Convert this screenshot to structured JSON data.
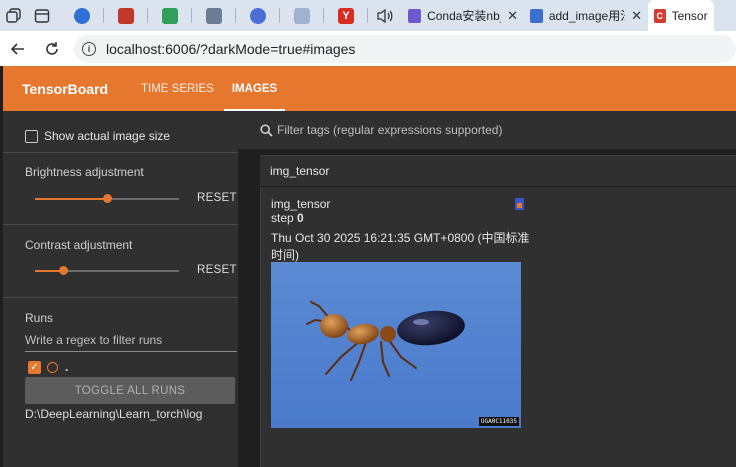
{
  "browser": {
    "tabs": [
      {
        "title": "Conda安装nb_",
        "close": "✕",
        "favicon_color": "#6a5acd"
      },
      {
        "title": "add_image用法",
        "close": "✕",
        "favicon_color": "#3b6fd4"
      },
      {
        "title": "TensorB",
        "close": "",
        "favicon_color": "#d23b2f",
        "favicon_letter": "C"
      }
    ],
    "pinned_colors": [
      "#2f6fd6",
      "#c0392b",
      "#2e9e5b",
      "#6b7c93",
      "#4a6fd4"
    ],
    "url": "localhost:6006/?darkMode=true#images"
  },
  "app": {
    "brand": "TensorBoard",
    "nav": [
      {
        "label": "TIME SERIES",
        "active": false
      },
      {
        "label": "IMAGES",
        "active": true
      }
    ],
    "accent": "#e6772f"
  },
  "sidebar": {
    "show_actual_size_label": "Show actual image size",
    "brightness_label": "Brightness adjustment",
    "brightness_value": 0.5,
    "contrast_label": "Contrast adjustment",
    "contrast_value": 0.2,
    "reset_label": "RESET",
    "runs_label": "Runs",
    "regex_placeholder": "Write a regex to filter runs",
    "run_name": ".",
    "toggle_all_label": "TOGGLE ALL RUNS",
    "log_dir": "D:\\DeepLearning\\Learn_torch\\log"
  },
  "main": {
    "filter_placeholder": "Filter tags (regular expressions supported)",
    "group_title": "img_tensor",
    "card": {
      "tag": "img_tensor",
      "step_label": "step",
      "step_value": "0",
      "timestamp": "Thu Oct 30 2025 16:21:35 GMT+0800 (中国标准时间)",
      "image_watermark": "UGA0C11035"
    }
  }
}
